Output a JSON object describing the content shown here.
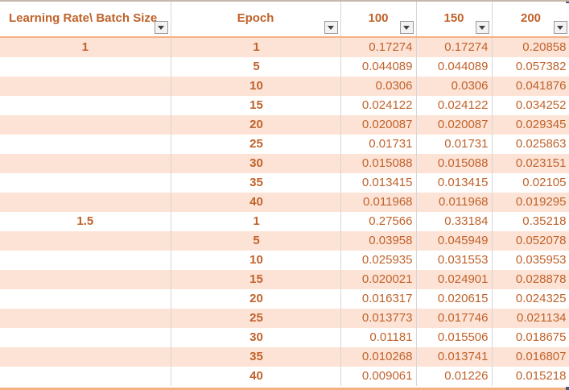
{
  "table": {
    "headers": [
      "Learning Rate\\ Batch Size",
      "Epoch",
      "100",
      "150",
      "200"
    ],
    "rows": [
      {
        "lr": "1",
        "epoch": "1",
        "v100": "0.17274",
        "v150": "0.17274",
        "v200": "0.20858"
      },
      {
        "lr": "",
        "epoch": "5",
        "v100": "0.044089",
        "v150": "0.044089",
        "v200": "0.057382"
      },
      {
        "lr": "",
        "epoch": "10",
        "v100": "0.0306",
        "v150": "0.0306",
        "v200": "0.041876"
      },
      {
        "lr": "",
        "epoch": "15",
        "v100": "0.024122",
        "v150": "0.024122",
        "v200": "0.034252"
      },
      {
        "lr": "",
        "epoch": "20",
        "v100": "0.020087",
        "v150": "0.020087",
        "v200": "0.029345"
      },
      {
        "lr": "",
        "epoch": "25",
        "v100": "0.01731",
        "v150": "0.01731",
        "v200": "0.025863"
      },
      {
        "lr": "",
        "epoch": "30",
        "v100": "0.015088",
        "v150": "0.015088",
        "v200": "0.023151"
      },
      {
        "lr": "",
        "epoch": "35",
        "v100": "0.013415",
        "v150": "0.013415",
        "v200": "0.02105"
      },
      {
        "lr": "",
        "epoch": "40",
        "v100": "0.011968",
        "v150": "0.011968",
        "v200": "0.019295"
      },
      {
        "lr": "1.5",
        "epoch": "1",
        "v100": "0.27566",
        "v150": "0.33184",
        "v200": "0.35218"
      },
      {
        "lr": "",
        "epoch": "5",
        "v100": "0.03958",
        "v150": "0.045949",
        "v200": "0.052078"
      },
      {
        "lr": "",
        "epoch": "10",
        "v100": "0.025935",
        "v150": "0.031553",
        "v200": "0.035953"
      },
      {
        "lr": "",
        "epoch": "15",
        "v100": "0.020021",
        "v150": "0.024901",
        "v200": "0.028878"
      },
      {
        "lr": "",
        "epoch": "20",
        "v100": "0.016317",
        "v150": "0.020615",
        "v200": "0.024325"
      },
      {
        "lr": "",
        "epoch": "25",
        "v100": "0.013773",
        "v150": "0.017746",
        "v200": "0.021134"
      },
      {
        "lr": "",
        "epoch": "30",
        "v100": "0.01181",
        "v150": "0.015506",
        "v200": "0.018675"
      },
      {
        "lr": "",
        "epoch": "35",
        "v100": "0.010268",
        "v150": "0.013741",
        "v200": "0.016807"
      },
      {
        "lr": "",
        "epoch": "40",
        "v100": "0.009061",
        "v150": "0.01226",
        "v200": "0.015218"
      }
    ]
  },
  "icons": {
    "filter": "filter-dropdown-icon"
  },
  "colors": {
    "header_text": "#c0622a",
    "band": "#fde3d6",
    "header_border": "#f4b183"
  }
}
